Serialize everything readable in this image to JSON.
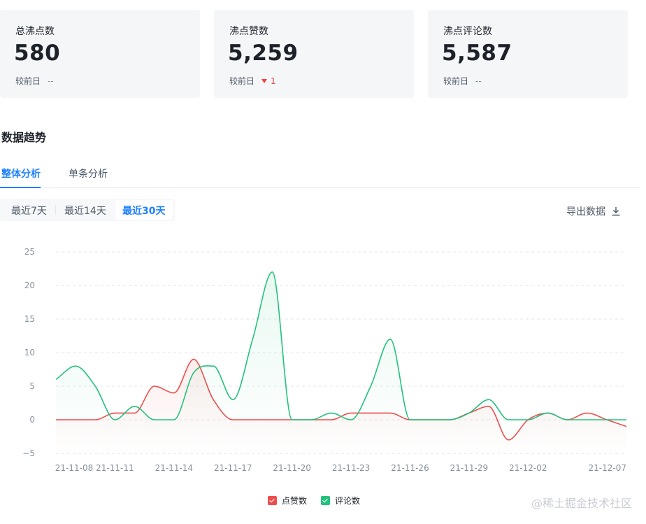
{
  "cards": [
    {
      "label": "总沸点数",
      "value": "580",
      "compare_label": "较前日",
      "delta": "--",
      "direction": "none"
    },
    {
      "label": "沸点赞数",
      "value": "5,259",
      "compare_label": "较前日",
      "delta": "1",
      "direction": "down"
    },
    {
      "label": "沸点评论数",
      "value": "5,587",
      "compare_label": "较前日",
      "delta": "--",
      "direction": "none"
    }
  ],
  "section_title": "数据趋势",
  "tabs": [
    {
      "label": "整体分析",
      "active": true
    },
    {
      "label": "单条分析",
      "active": false
    }
  ],
  "ranges": [
    {
      "label": "最近7天",
      "active": false
    },
    {
      "label": "最近14天",
      "active": false
    },
    {
      "label": "最近30天",
      "active": true
    }
  ],
  "export_label": "导出数据",
  "watermark": "@稀土掘金技术社区",
  "colors": {
    "accent": "#1e80ff",
    "likes": "#ee4d4d",
    "comments": "#23c17c"
  },
  "chart_data": {
    "type": "line",
    "x": [
      "21-11-08",
      "21-11-09",
      "21-11-10",
      "21-11-11",
      "21-11-12",
      "21-11-13",
      "21-11-14",
      "21-11-15",
      "21-11-16",
      "21-11-17",
      "21-11-18",
      "21-11-19",
      "21-11-20",
      "21-11-21",
      "21-11-22",
      "21-11-23",
      "21-11-24",
      "21-11-25",
      "21-11-26",
      "21-11-27",
      "21-11-28",
      "21-11-29",
      "21-11-30",
      "21-12-01",
      "21-12-02",
      "21-12-03",
      "21-12-04",
      "21-12-05",
      "21-12-06",
      "21-12-07"
    ],
    "x_tick_labels": [
      "21-11-08",
      "21-11-11",
      "21-11-14",
      "21-11-17",
      "21-11-20",
      "21-11-23",
      "21-11-26",
      "21-11-29",
      "21-12-02",
      "21-12-07"
    ],
    "series": [
      {
        "name": "点赞数",
        "color": "#ee4d4d",
        "values": [
          0,
          0,
          0,
          1,
          1,
          5,
          4,
          9,
          3,
          0,
          0,
          0,
          0,
          0,
          0,
          1,
          1,
          1,
          0,
          0,
          0,
          1,
          2,
          -3,
          0,
          1,
          0,
          1,
          0,
          -1
        ]
      },
      {
        "name": "评论数",
        "color": "#23c17c",
        "values": [
          6,
          8,
          5,
          0,
          2,
          0,
          0,
          7,
          8,
          3,
          12,
          22,
          0,
          0,
          1,
          0,
          5,
          12,
          0,
          0,
          0,
          1,
          3,
          0,
          0,
          1,
          0,
          0,
          0,
          0
        ]
      }
    ],
    "ylim": [
      -5,
      25
    ],
    "yticks": [
      -5,
      0,
      5,
      10,
      15,
      20,
      25
    ],
    "grid": true,
    "legend_position": "bottom-center",
    "smooth": true,
    "area_fill": true
  }
}
